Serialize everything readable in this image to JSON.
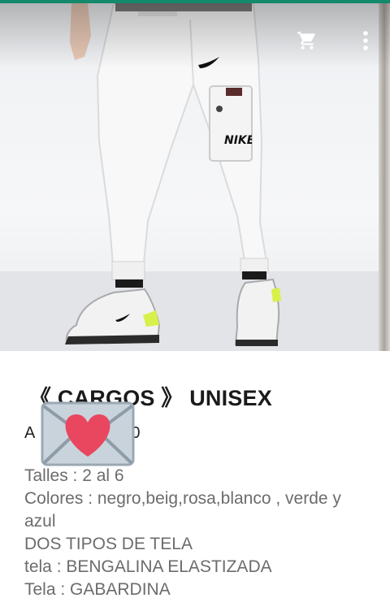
{
  "header": {
    "cart_icon": "cart-icon",
    "menu_icon": "overflow-menu-icon",
    "accent_color": "#138a6b"
  },
  "product": {
    "image_logo_text": "NIKE",
    "title": "《 CARGOS 》 UNISEX",
    "price_prefix": "A",
    "price_suffix": "0",
    "sticker_icon": "love-letter-emoji-icon",
    "description": [
      "Talles : 2 al 6",
      "Colores :  negro,beig,rosa,blanco , verde y azul",
      "DOS TIPOS DE TELA",
      "tela : BENGALINA ELASTIZADA",
      "Tela  : GABARDINA"
    ]
  }
}
